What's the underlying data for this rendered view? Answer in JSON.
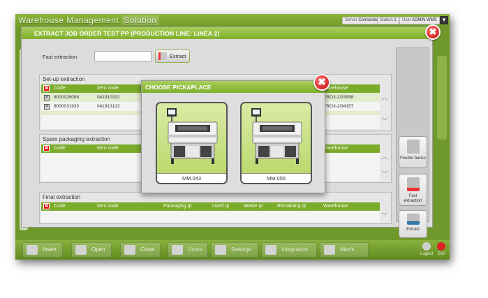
{
  "app": {
    "title": "Warehouse Management",
    "title_suffix": "Solution",
    "status": {
      "server_label": "Server",
      "server_value": "Connected",
      "station_label": "Station",
      "station_value": "1",
      "user_label": "User",
      "user_value": "ADMIN WMS"
    },
    "menu_glyph": "▼"
  },
  "taskbar": {
    "insert": "Insert",
    "open": "Open",
    "close": "Close",
    "users": "Users",
    "settings": "Settings",
    "integration": "Integration",
    "alerts": "Alerts",
    "logout": "Logout",
    "exit": "Exit"
  },
  "dialog": {
    "title": "EXTRACT JOB ORDER TEST PP (PRODUCTION LINE: LINEA 2)",
    "close_glyph": "✖",
    "fast_extraction_label": "Fast extraction",
    "fast_extraction_value": "",
    "extract_button": "Extract",
    "setup": {
      "title": "Set-up extraction",
      "columns": {
        "code": "Code",
        "item_code": "Item code",
        "warehouse": "Warehouse"
      },
      "rows": [
        {
          "code": "8000029098",
          "item_code": "041910332",
          "warehouse": "ERO3-2/33958"
        },
        {
          "code": "8000031933",
          "item_code": "041913123",
          "warehouse": "ERO3-2/34157"
        }
      ]
    },
    "spare": {
      "title": "Spare packaging extraction",
      "columns": {
        "code": "Code",
        "item_code": "Item code",
        "warehouse": "Warehouse"
      }
    },
    "final": {
      "title": "Final extraction",
      "columns": {
        "code": "Code",
        "item_code": "Item code",
        "packaging_qt": "Packaging qt",
        "used_qt": "Used qt",
        "waste_qt": "Waste qt",
        "remaining_qt": "Remaining qt",
        "warehouse": "Warehouse"
      }
    },
    "side": {
      "feeder_banks": "Feeder banks",
      "fast_extraction": "Fast extraction",
      "extract": "Extract"
    }
  },
  "modal": {
    "title": "CHOOSE PICK&PLACE",
    "close_glyph": "✖",
    "machines": [
      {
        "label": "MM.043"
      },
      {
        "label": "MM.055"
      }
    ]
  },
  "colors": {
    "accent_green": "#7fae2c",
    "close_red": "#c40000"
  }
}
